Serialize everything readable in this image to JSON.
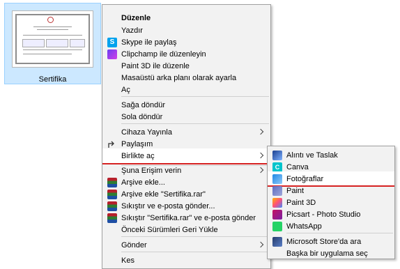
{
  "desktop": {
    "file_label": "Sertifika"
  },
  "menu": {
    "items": {
      "duzenle": "Düzenle",
      "yazdir": "Yazdır",
      "skype": "Skype ile paylaş",
      "clipchamp": "Clipchamp ile düzenleyin",
      "paint3d": "Paint 3D ile düzenle",
      "masaustu": "Masaüstü arka planı olarak ayarla",
      "ac": "Aç",
      "saga": "Sağa döndür",
      "sola": "Sola döndür",
      "cihaza": "Cihaza Yayınla",
      "paylasim": "Paylaşım",
      "birlikte": "Birlikte aç",
      "erisim": "Şuna Erişim verin",
      "arsive": "Arşive ekle...",
      "arsive_rar": "Arşive ekle \"Sertifika.rar\"",
      "sikistir_eposta": "Sıkıştır ve e-posta gönder...",
      "sikistir_rar_eposta": "Sıkıştır \"Sertifika.rar\" ve e-posta gönder",
      "onceki": "Önceki Sürümleri Geri Yükle",
      "gonder": "Gönder",
      "kes": "Kes"
    }
  },
  "submenu": {
    "items": {
      "alinti": "Alıntı ve Taslak",
      "canva": "Canva",
      "fotograflar": "Fotoğraflar",
      "paint": "Paint",
      "paint3d": "Paint 3D",
      "picsart": "Picsart - Photo Studio",
      "whatsapp": "WhatsApp",
      "store": "Microsoft Store'da ara",
      "baska": "Başka bir uygulama seç"
    }
  },
  "colors": {
    "highlight_underline": "#d62222",
    "selection": "#cce8ff"
  }
}
